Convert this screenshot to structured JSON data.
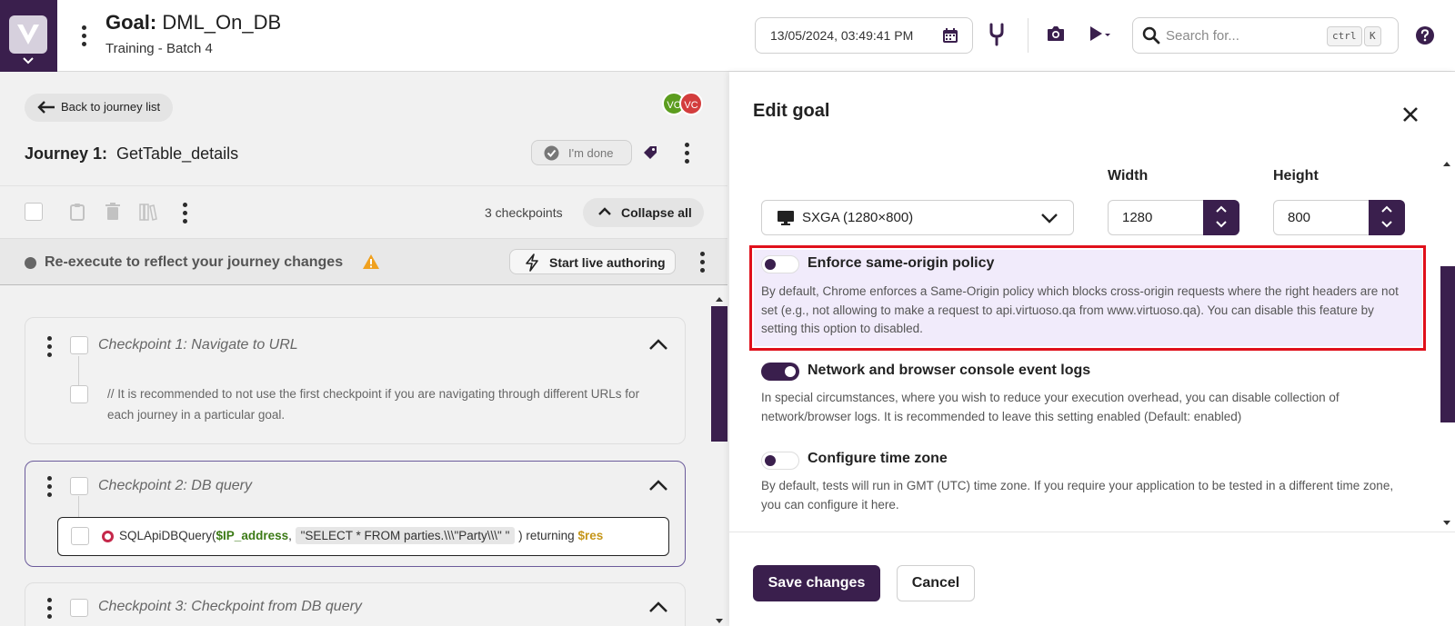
{
  "header": {
    "goal_label": "Goal:",
    "goal_name": "DML_On_DB",
    "subtitle": "Training - Batch 4",
    "date_value": "13/05/2024, 03:49:41 PM",
    "search_placeholder": "Search for...",
    "shortcut_ctrl": "ctrl",
    "shortcut_key": "K"
  },
  "left": {
    "back_label": "Back to journey list",
    "avatar1": "VC",
    "avatar2": "VC",
    "journey_label": "Journey 1:",
    "journey_name": "GetTable_details",
    "done_label": "I'm done",
    "checkpoint_count": "3 checkpoints",
    "collapse_label": "Collapse all",
    "banner_message": "Re-execute to reflect your journey changes",
    "live_label": "Start live authoring",
    "checkpoints": [
      {
        "title": "Checkpoint 1:  Navigate to URL",
        "comment": "// It is recommended to not use the first checkpoint if you are navigating through different URLs for each journey in a particular goal."
      },
      {
        "title": "Checkpoint 2:  DB query",
        "step": {
          "fn": "SQLApiDBQuery(",
          "var": "$IP_address",
          "comma": ",",
          "query": "\"SELECT * FROM parties.\\\\\\\"Party\\\\\\\" \"",
          "close": ") returning",
          "result": "$res"
        }
      },
      {
        "title": "Checkpoint 3:  Checkpoint from DB query"
      }
    ]
  },
  "panel": {
    "title": "Edit goal",
    "width_label": "Width",
    "height_label": "Height",
    "resolution": "SXGA (1280×800)",
    "width_value": "1280",
    "height_value": "800",
    "options": [
      {
        "title": "Enforce same-origin policy",
        "enabled": false,
        "desc": "By default, Chrome enforces a Same-Origin policy which blocks cross-origin requests where the right headers are not set (e.g., not allowing to make a request to api.virtuoso.qa from www.virtuoso.qa). You can disable this feature by setting this option to disabled."
      },
      {
        "title": "Network and browser console event logs",
        "enabled": true,
        "desc": "In special circumstances, where you wish to reduce your execution overhead, you can disable collection of network/browser logs. It is recommended to leave this setting enabled (Default: enabled)"
      },
      {
        "title": "Configure time zone",
        "enabled": false,
        "desc": "By default, tests will run in GMT (UTC) time zone. If you require your application to be tested in a different time zone, you can configure it here."
      }
    ],
    "save_label": "Save changes",
    "cancel_label": "Cancel"
  },
  "colors": {
    "brand": "#3a1f4d",
    "highlight_border": "#e0101b",
    "highlight_bg": "#f1ebfb"
  }
}
